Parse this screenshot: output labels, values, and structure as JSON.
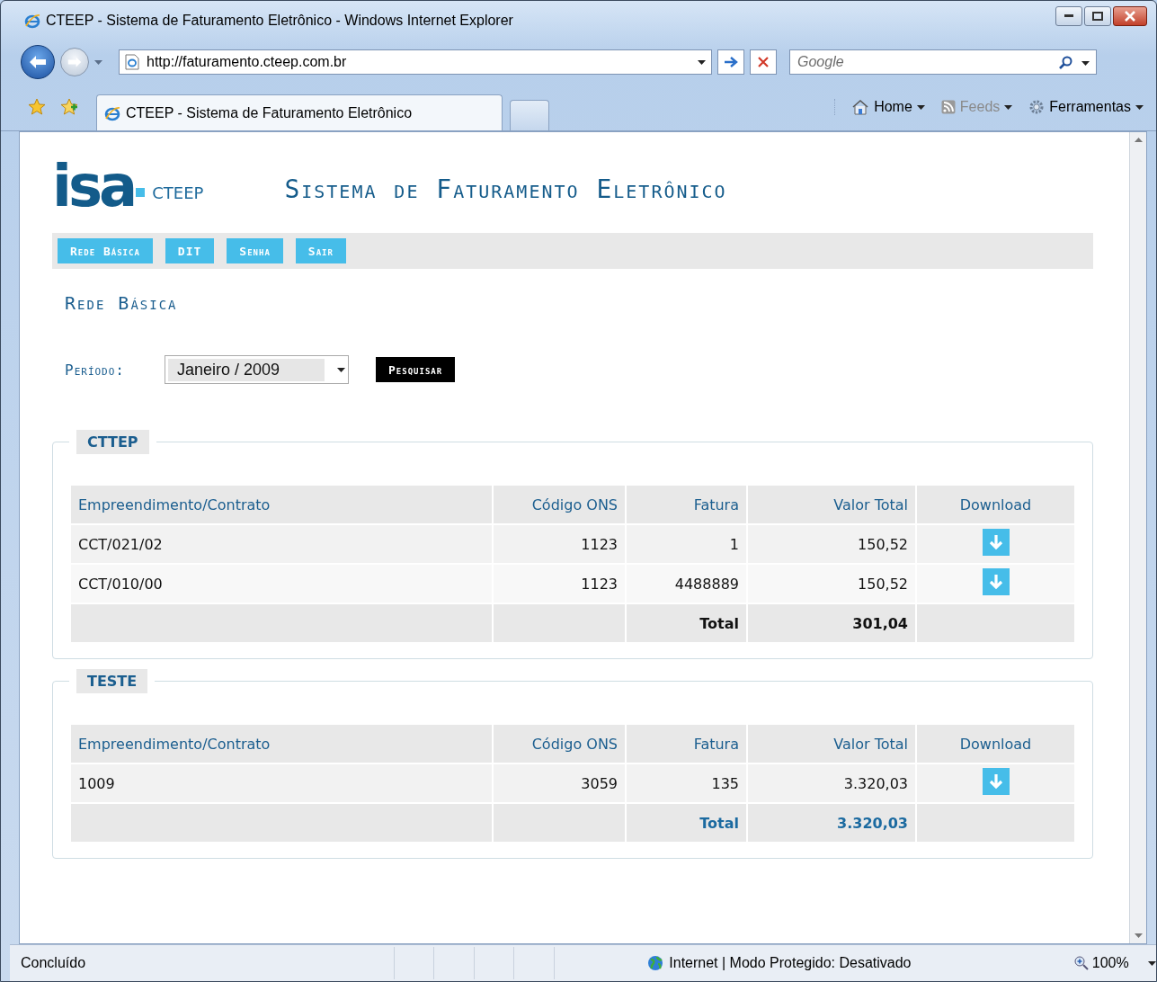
{
  "window": {
    "title": "CTEEP - Sistema de Faturamento Eletrônico - Windows Internet Explorer"
  },
  "address_bar": {
    "url": "http://faturamento.cteep.com.br"
  },
  "search": {
    "placeholder": "Google"
  },
  "tabs": [
    {
      "label": "CTEEP - Sistema de Faturamento Eletrônico",
      "selected": true
    }
  ],
  "command_bar": [
    {
      "kind": "home",
      "label": "Home",
      "disabled": false
    },
    {
      "kind": "feeds",
      "label": "Feeds",
      "disabled": true
    },
    {
      "kind": "tools",
      "label": "Ferramentas",
      "disabled": false
    }
  ],
  "page": {
    "logo": {
      "mark": "isa",
      "company": "CTEEP"
    },
    "title": "Sistema de Faturamento Eletrônico",
    "menu": [
      "Rede Básica",
      "DIT",
      "Senha",
      "Sair"
    ],
    "heading": "Rede Básica",
    "filter": {
      "label": "Período:",
      "value": "Janeiro / 2009",
      "button": "Pesquisar"
    },
    "groups": [
      {
        "title": "CTTEP",
        "columns": [
          "Empreendimento/Contrato",
          "Código ONS",
          "Fatura",
          "Valor Total",
          "Download"
        ],
        "rows": [
          {
            "cells": [
              "CCT/021/02",
              "1123",
              "1",
              "150,52"
            ]
          },
          {
            "cells": [
              "CCT/010/00",
              "1123",
              "4488889",
              "150,52"
            ]
          }
        ],
        "total": {
          "label": "Total",
          "value": "301,04",
          "highlighted": false
        }
      },
      {
        "title": "TESTE",
        "columns": [
          "Empreendimento/Contrato",
          "Código ONS",
          "Fatura",
          "Valor Total",
          "Download"
        ],
        "rows": [
          {
            "cells": [
              "1009",
              "3059",
              "135",
              "3.320,03"
            ]
          }
        ],
        "total": {
          "label": "Total",
          "value": "3.320,03",
          "highlighted": true
        }
      }
    ]
  },
  "status_bar": {
    "text": "Concluído",
    "zone": "Internet | Modo Protegido: Desativado",
    "zoom": "100%"
  }
}
